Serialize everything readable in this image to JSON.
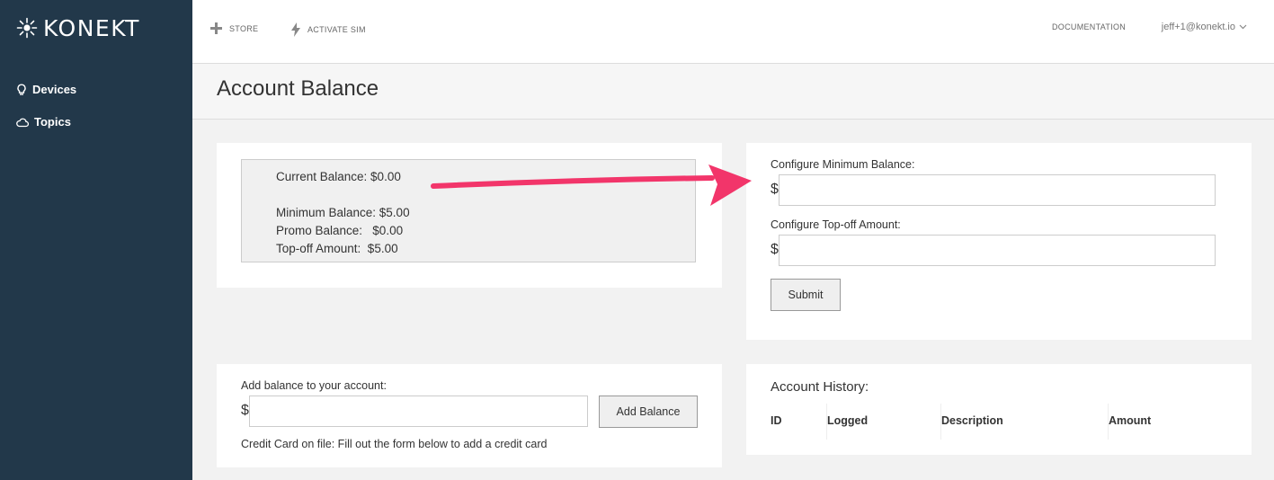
{
  "brand": {
    "name": "KONEKT"
  },
  "sidebar": {
    "items": [
      {
        "label": "Devices",
        "icon": "lightbulb-icon"
      },
      {
        "label": "Topics",
        "icon": "cloud-icon"
      }
    ]
  },
  "topnav": {
    "store_label": "STORE",
    "activate_label": "ACTIVATE SIM",
    "docs_label": "DOCUMENTATION",
    "user_email": "jeff+1@konekt.io"
  },
  "page": {
    "title": "Account Balance"
  },
  "balance_summary": {
    "current": "Current Balance: $0.00",
    "minimum": "Minimum Balance: $5.00",
    "promo": "Promo Balance:   $0.00",
    "topoff": "Top-off Amount:  $5.00"
  },
  "configure": {
    "min_label": "Configure Minimum Balance:",
    "topoff_label": "Configure Top-off Amount:",
    "currency": "$",
    "min_value": "",
    "topoff_value": "",
    "submit_label": "Submit"
  },
  "add_balance": {
    "label": "Add balance to your account:",
    "currency": "$",
    "value": "",
    "button_label": "Add Balance",
    "card_note": "Credit Card on file: Fill out the form below to add a credit card"
  },
  "history": {
    "title": "Account History:",
    "columns": [
      "ID",
      "Logged",
      "Description",
      "Amount"
    ]
  },
  "colors": {
    "sidebar_bg": "#22384a",
    "annotation_arrow": "#f2356a"
  }
}
